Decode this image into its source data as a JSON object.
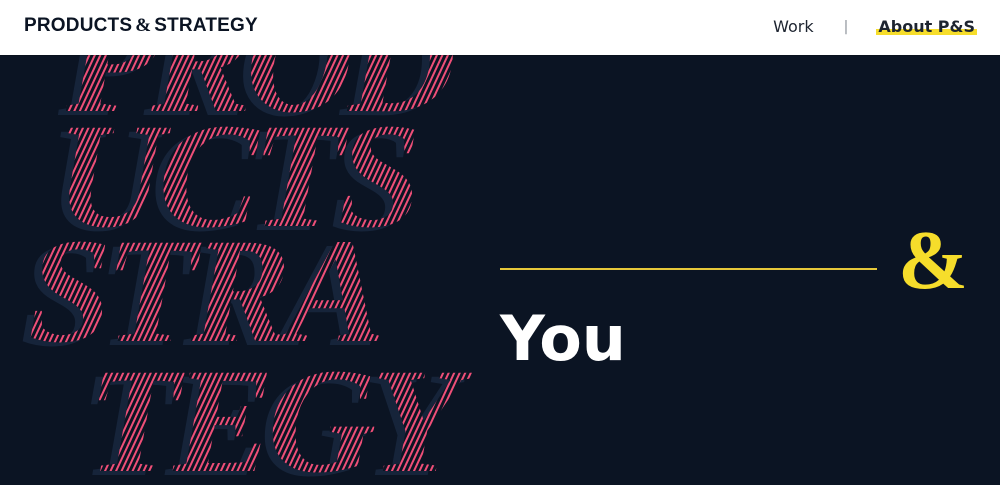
{
  "header": {
    "logo_left": "PRODUCTS",
    "logo_amp": "&",
    "logo_right": "STRATEGY",
    "nav": {
      "work": "Work",
      "separator": "|",
      "about": "About P&S"
    }
  },
  "hero": {
    "amp": "&",
    "headline": "You",
    "background_lines": [
      "PROD",
      "UCTS",
      "STRA",
      "TEGY"
    ]
  },
  "colors": {
    "background": "#0b1423",
    "accent_yellow": "#f6dd2b",
    "accent_pink": "#ef4f78",
    "header_bg": "#ffffff"
  }
}
